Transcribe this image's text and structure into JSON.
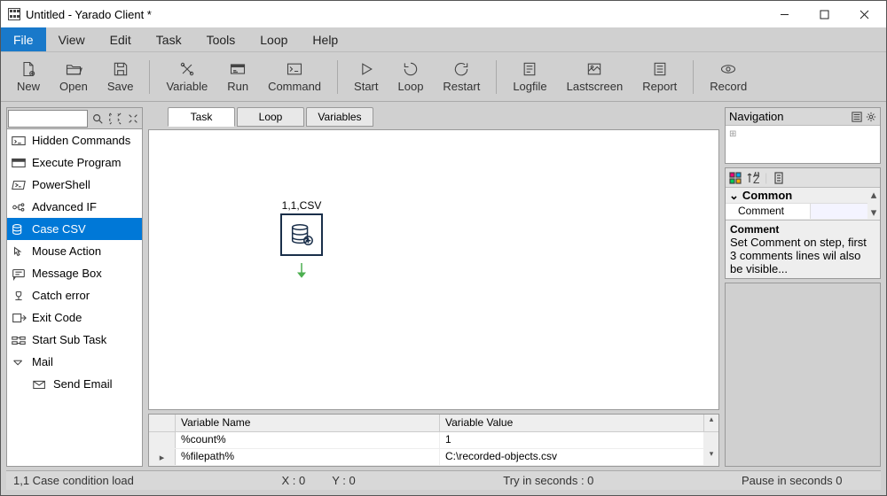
{
  "window": {
    "title": "Untitled   - Yarado Client *"
  },
  "menu": {
    "file": "File",
    "view": "View",
    "edit": "Edit",
    "task": "Task",
    "tools": "Tools",
    "loop": "Loop",
    "help": "Help"
  },
  "toolbar": {
    "new": "New",
    "open": "Open",
    "save": "Save",
    "variable": "Variable",
    "run": "Run",
    "command": "Command",
    "start": "Start",
    "loop": "Loop",
    "restart": "Restart",
    "logfile": "Logfile",
    "lastscreen": "Lastscreen",
    "report": "Report",
    "record": "Record"
  },
  "commands": {
    "hidden": "Hidden Commands",
    "execprog": "Execute Program",
    "powershell": "PowerShell",
    "advif": "Advanced IF",
    "casecsv": "Case CSV",
    "mouse": "Mouse Action",
    "msgbox": "Message Box",
    "catch": "Catch error",
    "exit": "Exit Code",
    "subtask": "Start Sub Task",
    "mail": "Mail",
    "sendemail": "Send Email"
  },
  "tabs": {
    "task": "Task",
    "loop": "Loop",
    "variables": "Variables"
  },
  "node": {
    "label": "1,1,CSV"
  },
  "vartable": {
    "col1": "Variable Name",
    "col2": "Variable Value",
    "r1c1": "%count%",
    "r1c2": "1",
    "r2c1": "%filepath%",
    "r2c2": "C:\\recorded-objects.csv"
  },
  "nav": {
    "title": "Navigation"
  },
  "props": {
    "cat": "Common",
    "row1k": "Comment",
    "desc_title": "Comment",
    "desc_body": "Set Comment on step, first 3 comments lines wil also be visible..."
  },
  "status": {
    "left": "1,1 Case condition load",
    "x": "X :  0",
    "y": "Y :  0",
    "try": "Try in seconds :     0",
    "pause": "Pause in seconds       0"
  }
}
